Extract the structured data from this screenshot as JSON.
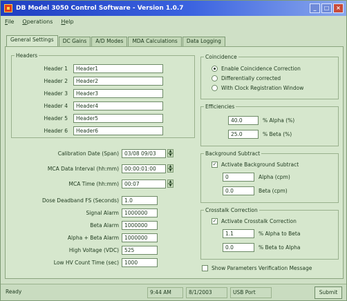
{
  "window": {
    "title": "DB Model 3050 Control Software  -  Version 1.0.7",
    "buttons": [
      "_",
      "□",
      "×"
    ]
  },
  "menu": [
    "File",
    "Operations",
    "Help"
  ],
  "tabs": [
    {
      "label": "General Settings",
      "active": true
    },
    {
      "label": "DC Gains",
      "active": false
    },
    {
      "label": "A/D Modes",
      "active": false
    },
    {
      "label": "MDA Calculations",
      "active": false
    },
    {
      "label": "Data Logging",
      "active": false
    }
  ],
  "headers": {
    "group_label": "Headers",
    "items": [
      {
        "label": "Header 1",
        "value": "Header1"
      },
      {
        "label": "Header 2",
        "value": "Header2"
      },
      {
        "label": "Header 3",
        "value": "Header3"
      },
      {
        "label": "Header 4",
        "value": "Header4"
      },
      {
        "label": "Header 5",
        "value": "Header5"
      },
      {
        "label": "Header 6",
        "value": "Header6"
      }
    ]
  },
  "settings": [
    {
      "label": "Calibration Date (Span)",
      "value": "03/08 09/03"
    },
    {
      "label": "MCA Data Interval (hh:mm)",
      "value": "00:00:01:00"
    },
    {
      "label": "MCA Time (hh:mm)",
      "value": "00:07"
    },
    {
      "label": "Dose Deadband FS (Seconds)",
      "value": "1.0"
    },
    {
      "label": "Signal Alarm",
      "value": "1000000"
    },
    {
      "label": "Beta Alarm",
      "value": "1000000"
    },
    {
      "label": "Alpha + Beta Alarm",
      "value": "1000000"
    },
    {
      "label": "High Voltage (VDC)",
      "value": "525"
    },
    {
      "label": "Low HV Count Time (sec)",
      "value": "1000"
    }
  ],
  "coincidence": {
    "group_label": "Coincidence",
    "options": [
      {
        "label": "Enable Coincidence Correction",
        "selected": true
      },
      {
        "label": "Differentially corrected",
        "selected": false
      },
      {
        "label": "With Clock Registration Window",
        "selected": false
      }
    ]
  },
  "efficiencies": {
    "group_label": "Efficiencies",
    "rows": [
      {
        "value": "40.0",
        "unit": "% Alpha (%)"
      },
      {
        "value": "25.0",
        "unit": "% Beta (%)"
      }
    ]
  },
  "background": {
    "group_label": "Background Subtract",
    "checkbox_label": "Activate Background Subtract",
    "checked": true,
    "rows": [
      {
        "value": "0",
        "unit": "Alpha (cpm)"
      },
      {
        "value": "0.0",
        "unit": "Beta (cpm)"
      }
    ]
  },
  "crosstalk": {
    "group_label": "Crosstalk Correction",
    "checkbox_label": "Activate Crosstalk Correction",
    "checked": true,
    "rows": [
      {
        "value": "1.1",
        "unit": "% Alpha to Beta"
      },
      {
        "value": "0.0",
        "unit": "% Beta to Alpha"
      }
    ]
  },
  "bottom_check": {
    "label": "Show Parameters Verification Message",
    "checked": false
  },
  "statusbar": {
    "left": "Ready",
    "cells": [
      "9:44 AM",
      "8/1/2003",
      "USB Port"
    ],
    "button": "Submit"
  }
}
